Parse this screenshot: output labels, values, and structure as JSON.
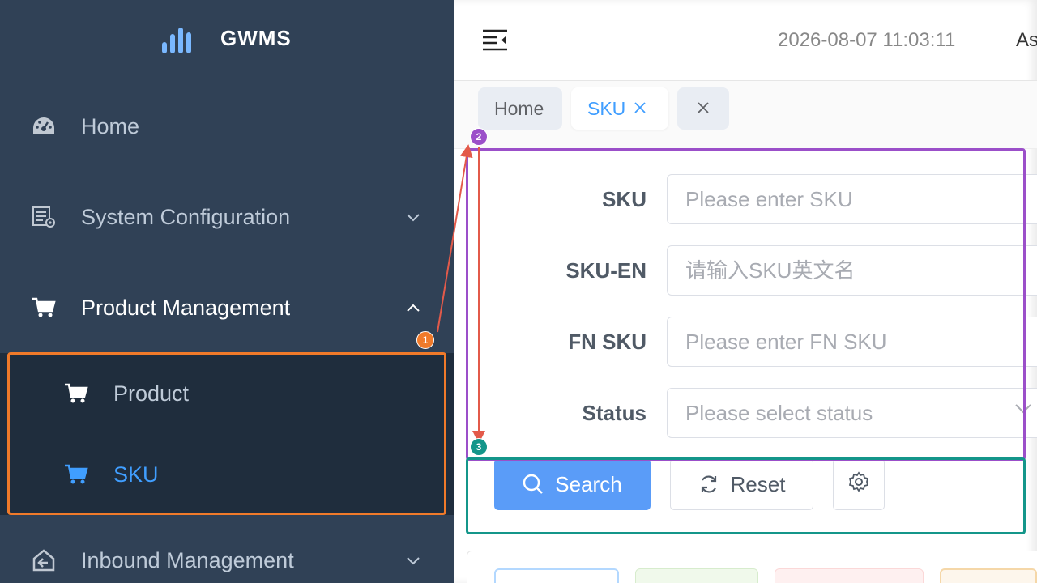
{
  "app": {
    "title": "GWMS"
  },
  "sidebar": {
    "items": [
      {
        "label": "Home",
        "icon": "dashboard-icon"
      },
      {
        "label": "System Configuration",
        "icon": "system-config-icon"
      },
      {
        "label": "Product Management",
        "icon": "cart-icon",
        "expanded": true
      },
      {
        "label": "Inbound Management",
        "icon": "inbound-icon"
      }
    ],
    "submenu": [
      {
        "label": "Product",
        "icon": "cart-icon"
      },
      {
        "label": "SKU",
        "icon": "cart-icon",
        "active": true
      }
    ]
  },
  "navbar": {
    "datetime": "2026-08-07 11:03:11",
    "right_text": "As"
  },
  "tags": {
    "home": "Home",
    "sku": "SKU"
  },
  "form": {
    "sku_label": "SKU",
    "sku_placeholder": "Please enter SKU",
    "sku_en_label": "SKU-EN",
    "sku_en_placeholder": "请输入SKU英文名",
    "fnsku_label": "FN SKU",
    "fnsku_placeholder": "Please enter FN SKU",
    "status_label": "Status",
    "status_placeholder": "Please select status"
  },
  "buttons": {
    "search": "Search",
    "reset": "Reset"
  },
  "annotations": [
    {
      "number": "1",
      "color": "#f07a2a"
    },
    {
      "number": "2",
      "color": "#9b4fc9"
    },
    {
      "number": "3",
      "color": "#14968a"
    }
  ],
  "colors": {
    "sidebar_bg": "#304156",
    "submenu_bg": "#1f2d3d",
    "accent": "#409eff",
    "search_btn": "#5a9cf8"
  }
}
